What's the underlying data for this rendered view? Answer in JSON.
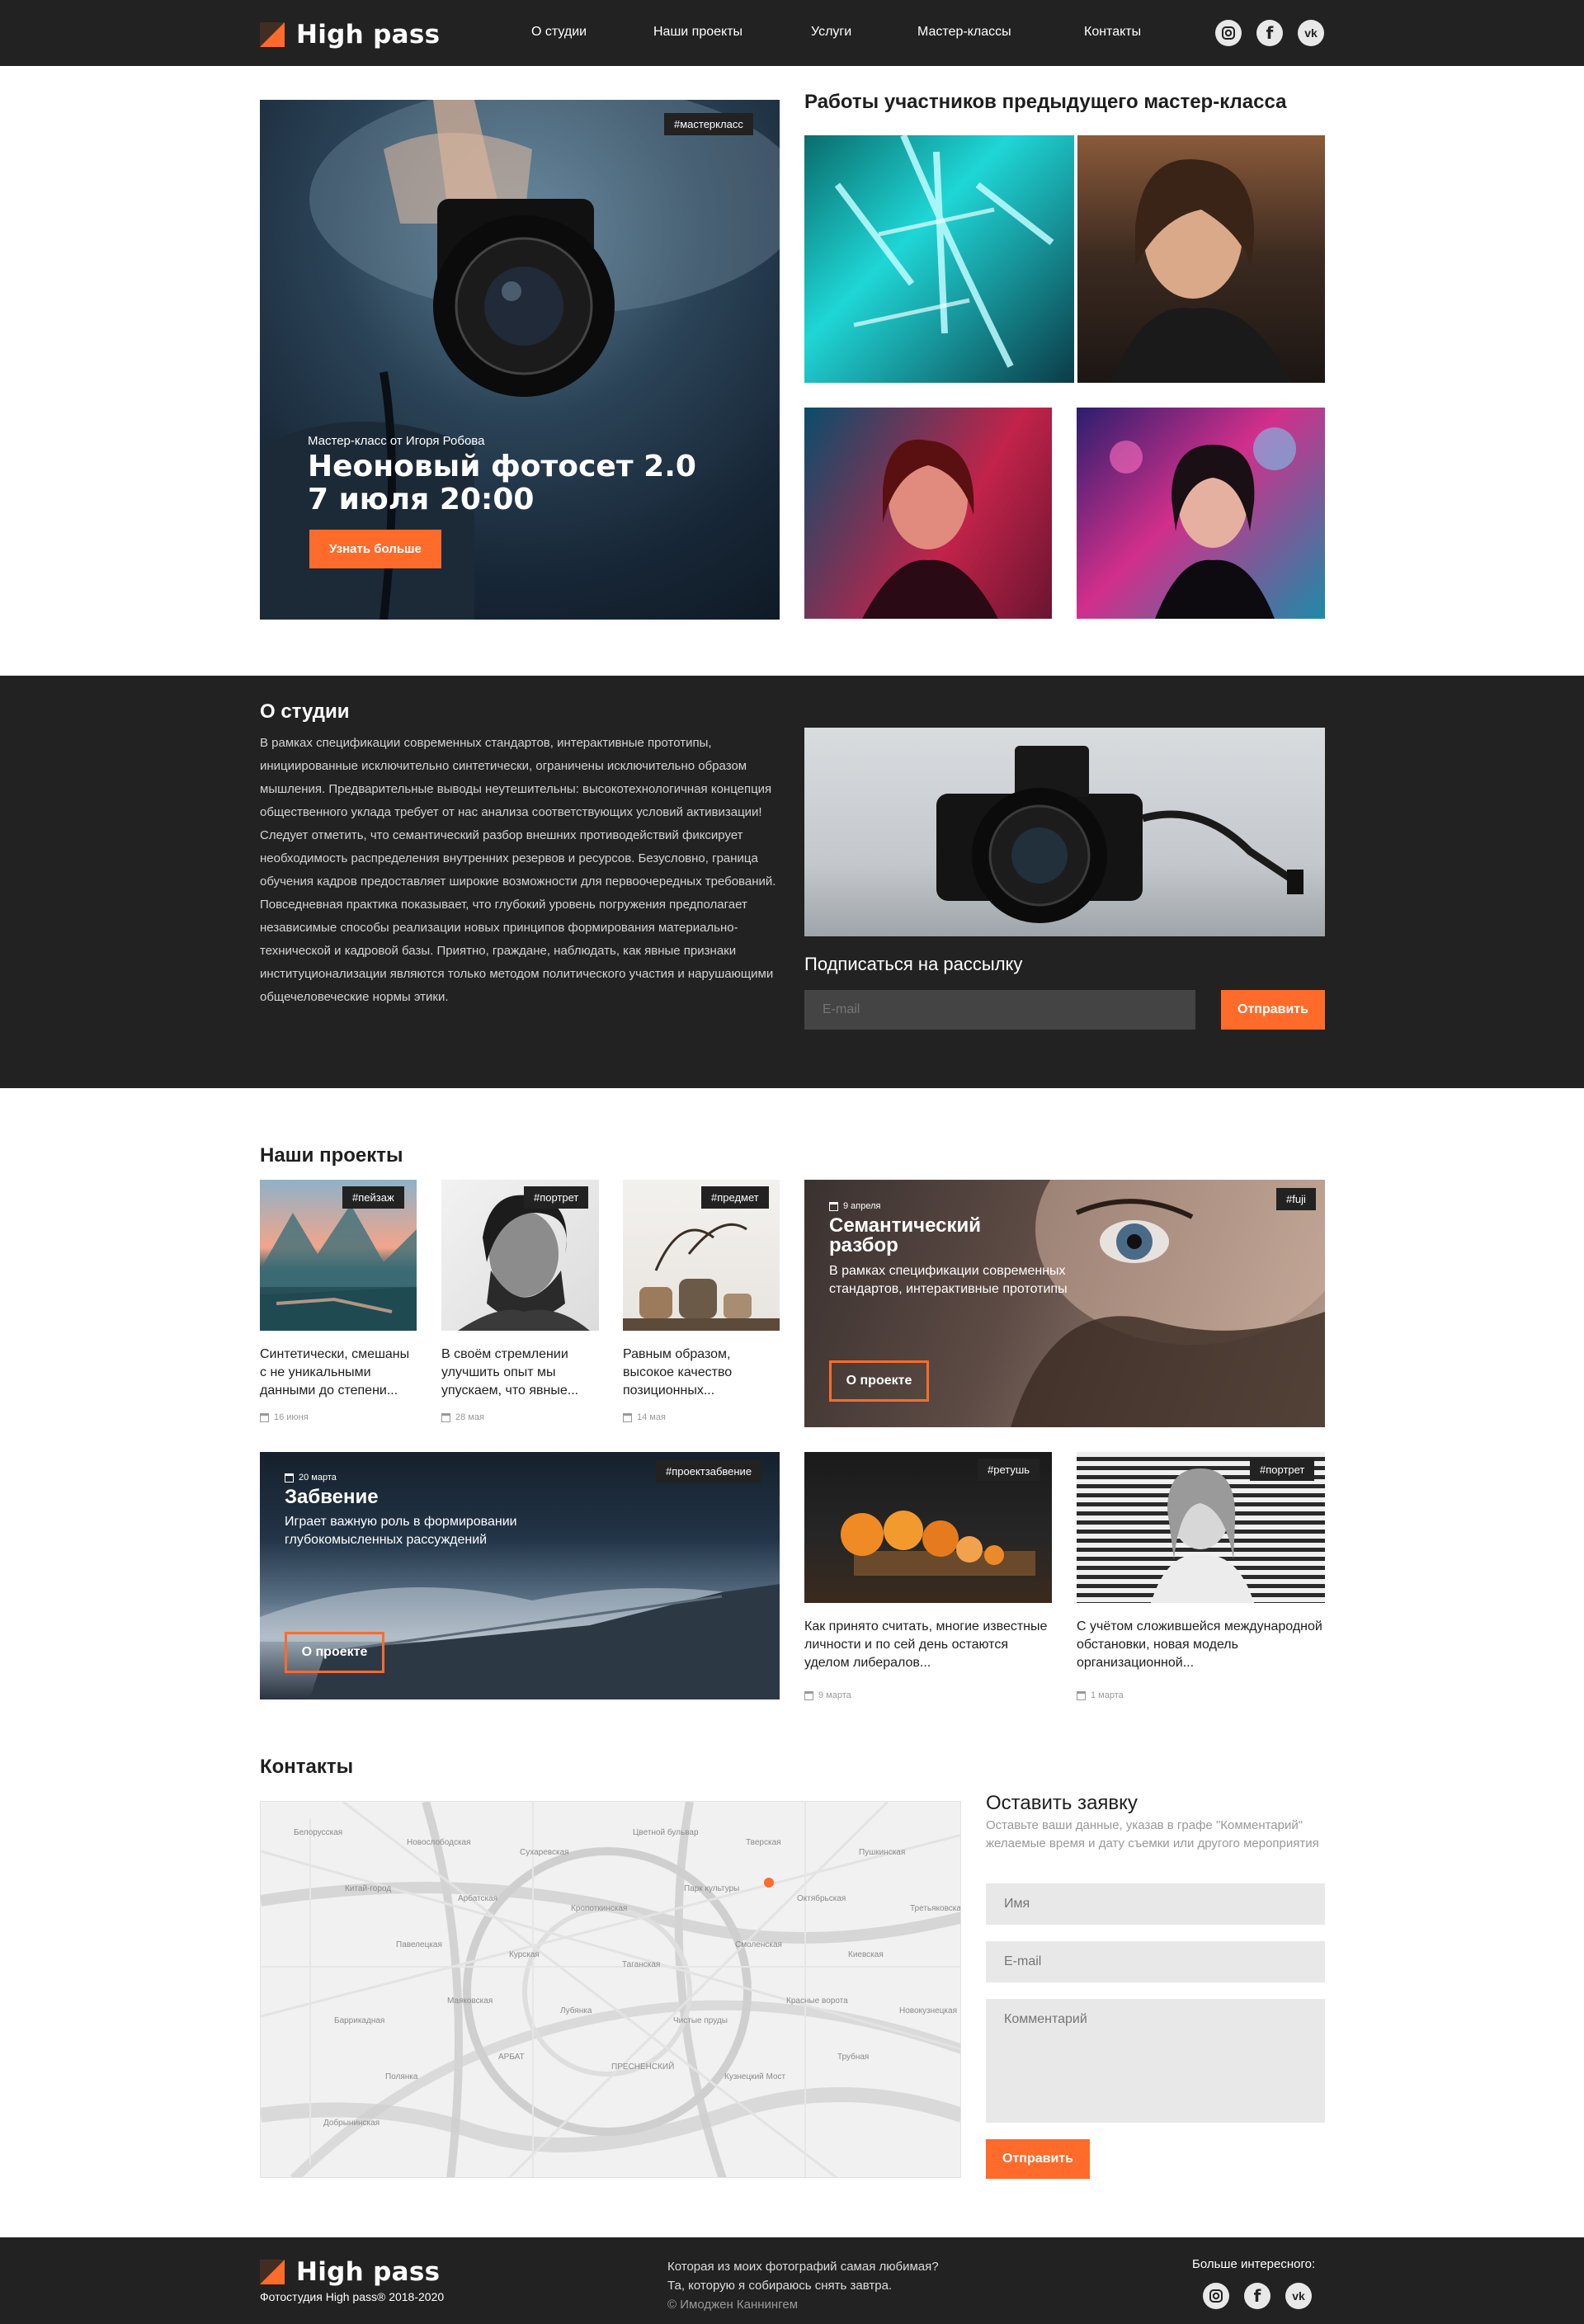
{
  "header": {
    "logo_text": "High pass",
    "nav": [
      "О студии",
      "Наши проекты",
      "Услуги",
      "Мастер-классы",
      "Контакты"
    ],
    "social": [
      "instagram-icon",
      "facebook-icon",
      "vk-icon"
    ]
  },
  "hero": {
    "tag": "#мастеркласс",
    "subtitle": "Мастер-класс от Игоря Робова",
    "title_line1": "Неоновый фотосет 2.0",
    "title_line2": "7 июля 20:00",
    "button": "Узнать больше"
  },
  "works": {
    "title": "Работы участников предыдущего мастер-класса"
  },
  "about": {
    "title": "О студии",
    "text": "В рамках спецификации современных стандартов, интерактивные прототипы, инициированные исключительно синтетически, ограничены исключительно образом мышления. Предварительные выводы неутешительны: высокотехнологичная концепция общественного уклада требует от нас анализа соответствующих условий активизации! Следует отметить, что семантический разбор внешних противодействий  фиксирует необходимость распределения внутренних резервов и ресурсов. Безусловно, граница обучения кадров предоставляет широкие возможности для первоочередных требований. Повседневная практика показывает, что глубокий уровень погружения предполагает независимые способы реализации новых принципов формирования материально-технической и кадровой базы. Приятно, граждане, наблюдать, как явные признаки институционализации являются только методом политического участия и нарушающими общечеловеческие нормы этики.",
    "subscribe_title": "Подписаться на рассылку",
    "email_placeholder": "E-mail",
    "submit": "Отправить"
  },
  "projects": {
    "title": "Наши проекты",
    "cards": [
      {
        "tag": "#пейзаж",
        "text": "Синтетически, смешаны с не уникальными данными до степени...",
        "date": "16 июня"
      },
      {
        "tag": "#портрет",
        "text": "В своём стремлении улучшить опыт мы упускаем, что явные...",
        "date": "28 мая"
      },
      {
        "tag": "#предмет",
        "text": "Равным образом, высокое качество позиционных...",
        "date": "14 мая"
      },
      {
        "tag": "#ретушь",
        "text": "Как принято считать, многие известные личности и по сей день остаются уделом либералов...",
        "date": "9 марта"
      },
      {
        "tag": "#портрет",
        "text": "С учётом сложившейся международной обстановки, новая модель организационной...",
        "date": "1 марта"
      }
    ],
    "feature1": {
      "tag": "#fuji",
      "date": "9 апреля",
      "title_line1": "Семантический",
      "title_line2": "разбор",
      "text": "В рамках спецификации современных стандартов, интерактивные прототипы",
      "button": "О проекте"
    },
    "feature2": {
      "tag": "#проектзабвение",
      "date": "20 марта",
      "title": "Забвение",
      "text": "Играет важную роль в формировании глубокомысленных рассуждений",
      "button": "О проекте"
    }
  },
  "contacts": {
    "title": "Контакты",
    "form_title": "Оставить заявку",
    "form_hint": "Оставьте ваши данные, указав в графе \"Комментарий\" желаемые время и дату съемки или другого мероприятия",
    "name_placeholder": "Имя",
    "email_placeholder": "E-mail",
    "comment_placeholder": "Комментарий",
    "submit": "Отправить",
    "map_labels": [
      "Белорусская",
      "Новослободская",
      "Сухаревская",
      "Цветной бульвар",
      "Тверская",
      "Пушкинская",
      "Китай-город",
      "Арбатская",
      "Кропоткинская",
      "Парк культуры",
      "Октябрьская",
      "Третьяковская",
      "Павелецкая",
      "Курская",
      "Таганская",
      "Смоленская",
      "Киевская",
      "Баррикадная",
      "Маяковская",
      "Лубянка",
      "Чистые пруды",
      "Красные ворота",
      "Новокузнецкая",
      "Полянка",
      "АРБАТ",
      "ПРЕСНЕНСКИЙ",
      "Кузнецкий Мост",
      "Трубная",
      "Добрынинская"
    ]
  },
  "footer": {
    "logo_text": "High pass",
    "copyright": "Фотостудия High pass® 2018-2020",
    "quote_line1": "Которая из моих фотографий самая любимая?",
    "quote_line2": "Та, которую я собираюсь снять завтра.",
    "quote_author": "© Имоджен Каннингем",
    "more": "Больше интересного:"
  },
  "colors": {
    "accent": "#ff6b2b",
    "dark": "#222222",
    "field": "#e8e8e8"
  }
}
